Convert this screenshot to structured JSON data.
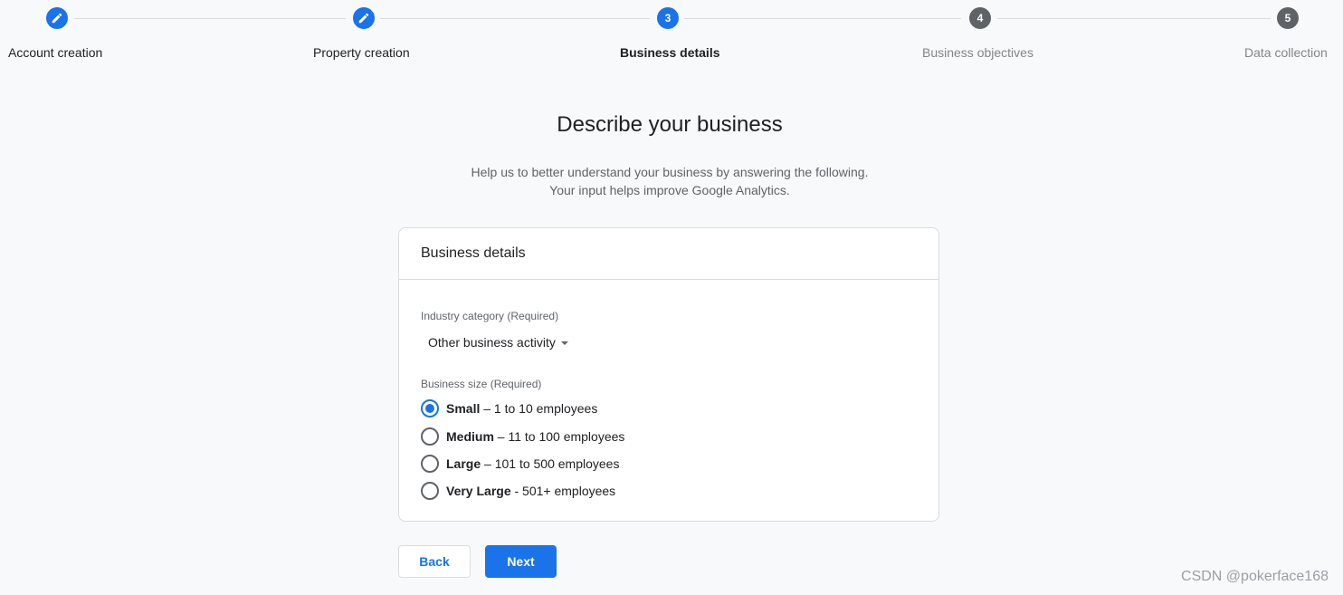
{
  "stepper": {
    "steps": [
      {
        "label": "Account creation",
        "marker": "pencil-icon",
        "state": "done"
      },
      {
        "label": "Property creation",
        "marker": "pencil-icon",
        "state": "done"
      },
      {
        "label": "Business details",
        "marker": "3",
        "state": "active"
      },
      {
        "label": "Business objectives",
        "marker": "4",
        "state": "pending"
      },
      {
        "label": "Data collection",
        "marker": "5",
        "state": "pending"
      }
    ]
  },
  "page": {
    "title": "Describe your business",
    "subtitle_line1": "Help us to better understand your business by answering the following.",
    "subtitle_line2": "Your input helps improve Google Analytics."
  },
  "card": {
    "header": "Business details",
    "industry": {
      "label": "Industry category (Required)",
      "selected": "Other business activity"
    },
    "size": {
      "label": "Business size (Required)",
      "options": [
        {
          "name": "Small",
          "detail": " – 1 to 10 employees",
          "checked": true
        },
        {
          "name": "Medium",
          "detail": " – 11 to 100 employees",
          "checked": false
        },
        {
          "name": "Large",
          "detail": " – 101 to 500 employees",
          "checked": false
        },
        {
          "name": "Very Large",
          "detail": " - 501+ employees",
          "checked": false
        }
      ]
    }
  },
  "buttons": {
    "back": "Back",
    "next": "Next"
  },
  "watermark": "CSDN @pokerface168",
  "colors": {
    "accent": "#1a73e8",
    "inactive_step": "#5f6368",
    "background": "#f8f9fa"
  }
}
